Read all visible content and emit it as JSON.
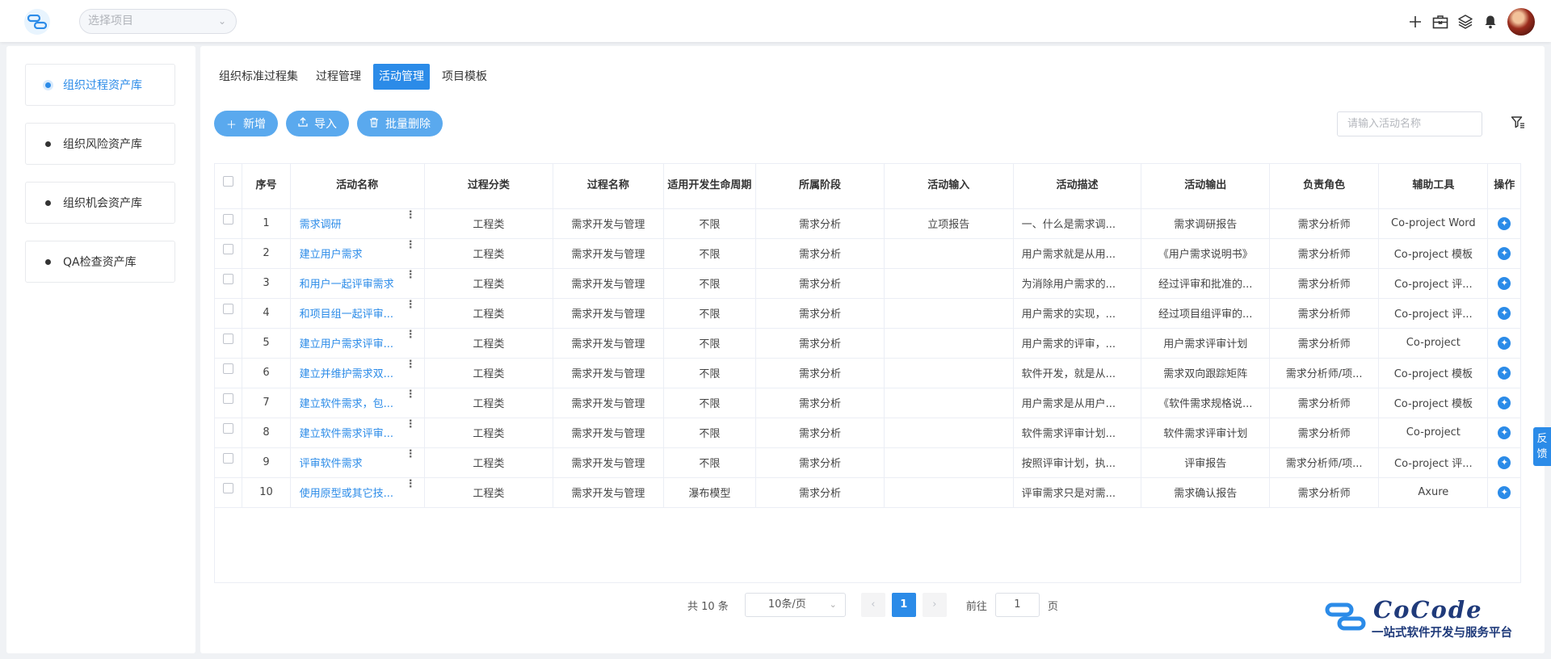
{
  "header": {
    "project_placeholder": "选择项目"
  },
  "sidebar": {
    "items": [
      {
        "label": "组织过程资产库",
        "active": true
      },
      {
        "label": "组织风险资产库",
        "active": false
      },
      {
        "label": "组织机会资产库",
        "active": false
      },
      {
        "label": "QA检查资产库",
        "active": false
      }
    ]
  },
  "tabs": [
    "组织标准过程集",
    "过程管理",
    "活动管理",
    "项目模板"
  ],
  "active_tab": "活动管理",
  "toolbar": {
    "add": "新增",
    "import": "导入",
    "batch_delete": "批量删除",
    "search_placeholder": "请输入活动名称"
  },
  "table": {
    "headers": [
      "序号",
      "活动名称",
      "过程分类",
      "过程名称",
      "适用开发生命周期",
      "所属阶段",
      "活动输入",
      "活动描述",
      "活动输出",
      "负责角色",
      "辅助工具",
      "操作"
    ],
    "rows": [
      {
        "no": "1",
        "name": "需求调研",
        "category": "工程类",
        "process": "需求开发与管理",
        "lifecycle": "不限",
        "stage": "需求分析",
        "input": "立项报告",
        "desc": "一、什么是需求调...",
        "output": "需求调研报告",
        "role": "需求分析师",
        "tool": "Co-project Word"
      },
      {
        "no": "2",
        "name": "建立用户需求",
        "category": "工程类",
        "process": "需求开发与管理",
        "lifecycle": "不限",
        "stage": "需求分析",
        "input": "",
        "desc": "用户需求就是从用...",
        "output": "《用户需求说明书》",
        "role": "需求分析师",
        "tool": "Co-project 模板"
      },
      {
        "no": "3",
        "name": "和用户一起评审需求",
        "category": "工程类",
        "process": "需求开发与管理",
        "lifecycle": "不限",
        "stage": "需求分析",
        "input": "",
        "desc": "为消除用户需求的...",
        "output": "经过评审和批准的...",
        "role": "需求分析师",
        "tool": "Co-project 评..."
      },
      {
        "no": "4",
        "name": "和项目组一起评审...",
        "category": "工程类",
        "process": "需求开发与管理",
        "lifecycle": "不限",
        "stage": "需求分析",
        "input": "",
        "desc": "用户需求的实现，...",
        "output": "经过项目组评审的...",
        "role": "需求分析师",
        "tool": "Co-project 评..."
      },
      {
        "no": "5",
        "name": "建立用户需求评审...",
        "category": "工程类",
        "process": "需求开发与管理",
        "lifecycle": "不限",
        "stage": "需求分析",
        "input": "",
        "desc": "用户需求的评审，...",
        "output": "用户需求评审计划",
        "role": "需求分析师",
        "tool": "Co-project"
      },
      {
        "no": "6",
        "name": "建立并维护需求双...",
        "category": "工程类",
        "process": "需求开发与管理",
        "lifecycle": "不限",
        "stage": "需求分析",
        "input": "",
        "desc": "软件开发，就是从...",
        "output": "需求双向跟踪矩阵",
        "role": "需求分析师/项...",
        "tool": "Co-project 模板"
      },
      {
        "no": "7",
        "name": "建立软件需求，包...",
        "category": "工程类",
        "process": "需求开发与管理",
        "lifecycle": "不限",
        "stage": "需求分析",
        "input": "",
        "desc": "用户需求是从用户...",
        "output": "《软件需求规格说...",
        "role": "需求分析师",
        "tool": "Co-project 模板"
      },
      {
        "no": "8",
        "name": "建立软件需求评审...",
        "category": "工程类",
        "process": "需求开发与管理",
        "lifecycle": "不限",
        "stage": "需求分析",
        "input": "",
        "desc": "软件需求评审计划...",
        "output": "软件需求评审计划",
        "role": "需求分析师",
        "tool": "Co-project"
      },
      {
        "no": "9",
        "name": "评审软件需求",
        "category": "工程类",
        "process": "需求开发与管理",
        "lifecycle": "不限",
        "stage": "需求分析",
        "input": "",
        "desc": "按照评审计划，执...",
        "output": "评审报告",
        "role": "需求分析师/项...",
        "tool": "Co-project 评..."
      },
      {
        "no": "10",
        "name": "使用原型或其它技...",
        "category": "工程类",
        "process": "需求开发与管理",
        "lifecycle": "瀑布模型",
        "stage": "需求分析",
        "input": "",
        "desc": "评审需求只是对需...",
        "output": "需求确认报告",
        "role": "需求分析师",
        "tool": "Axure"
      }
    ]
  },
  "pagination": {
    "total": "共 10 条",
    "page_size": "10条/页",
    "current_page": "1",
    "goto_label": "前往",
    "goto_value": "1",
    "page_unit": "页"
  },
  "brand": {
    "name": "CoCode",
    "slogan": "一站式软件开发与服务平台"
  },
  "feedback": "反馈",
  "colors": {
    "primary": "#2b8be8",
    "button": "#5aa9ee",
    "brand_dark": "#1f3a7a"
  }
}
